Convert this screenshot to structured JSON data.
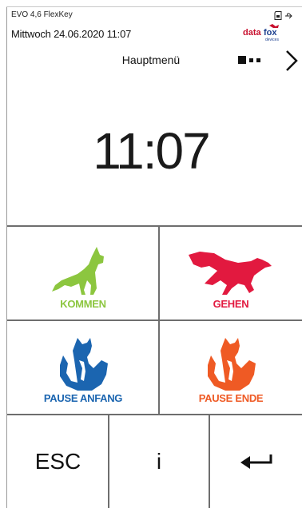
{
  "header": {
    "device_info": "EVO 4,6 FlexKey",
    "datetime": "Mittwoch 24.06.2020 11:07",
    "title": "Hauptmenü",
    "logo_text": "datafox",
    "logo_subtext": "devices"
  },
  "clock": {
    "time": "11:07"
  },
  "tiles": {
    "kommen": {
      "label": "KOMMEN",
      "color": "#8cc63f"
    },
    "gehen": {
      "label": "GEHEN",
      "color": "#e2193f"
    },
    "pause_anfang": {
      "label": "PAUSE ANFANG",
      "color": "#1b65b0"
    },
    "pause_ende": {
      "label": "PAUSE ENDE",
      "color": "#ef5a24"
    }
  },
  "bottom": {
    "esc_label": "ESC",
    "info_label": "i",
    "enter_icon": "enter-arrow-icon"
  },
  "icons": [
    "sd-card-icon",
    "usb-icon",
    "chevron-right-icon",
    "page-indicator-icon"
  ]
}
